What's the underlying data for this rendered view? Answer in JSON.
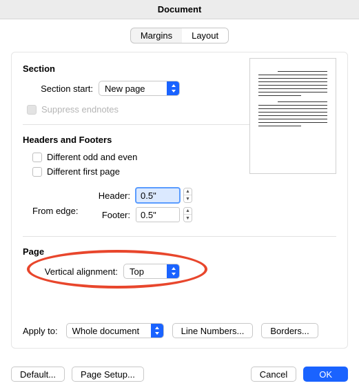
{
  "dialog": {
    "title": "Document"
  },
  "tabs": {
    "margins": "Margins",
    "layout": "Layout",
    "active": "layout"
  },
  "section": {
    "heading": "Section",
    "start_label": "Section start:",
    "start_value": "New page",
    "suppress_endnotes_label": "Suppress endnotes"
  },
  "headers_footers": {
    "heading": "Headers and Footers",
    "diff_odd_even_label": "Different odd and even",
    "diff_first_page_label": "Different first page",
    "from_edge_label": "From edge:",
    "header_label": "Header:",
    "header_value": "0.5\"",
    "footer_label": "Footer:",
    "footer_value": "0.5\""
  },
  "page": {
    "heading": "Page",
    "valign_label": "Vertical alignment:",
    "valign_value": "Top"
  },
  "apply": {
    "label": "Apply to:",
    "value": "Whole document",
    "line_numbers": "Line Numbers...",
    "borders": "Borders..."
  },
  "buttons": {
    "default": "Default...",
    "page_setup": "Page Setup...",
    "cancel": "Cancel",
    "ok": "OK"
  }
}
